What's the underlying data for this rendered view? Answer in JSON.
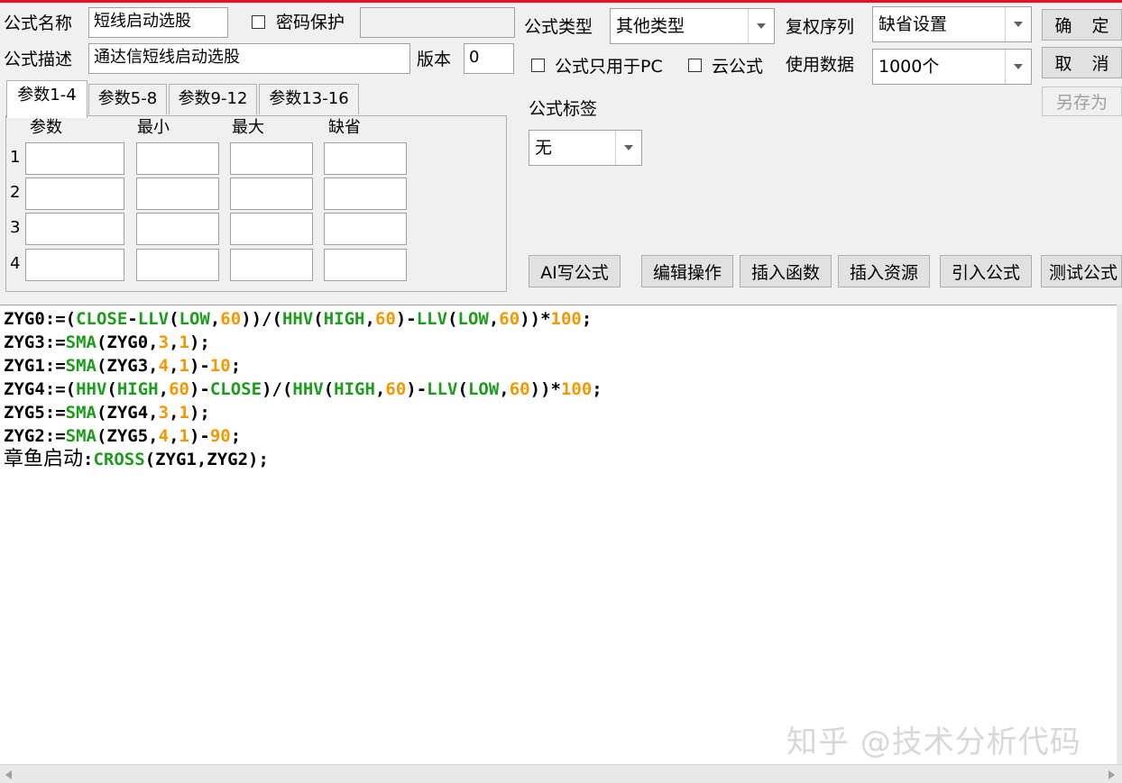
{
  "form": {
    "name_label": "公式名称",
    "name_value": "短线启动选股",
    "password_label": "密码保护",
    "desc_label": "公式描述",
    "desc_value": "通达信短线启动选股",
    "version_label": "版本",
    "version_value": "0"
  },
  "options": {
    "type_label": "公式类型",
    "type_value": "其他类型",
    "rights_label": "复权序列",
    "rights_value": "缺省设置",
    "pc_only_label": "公式只用于PC",
    "cloud_label": "云公式",
    "data_label": "使用数据",
    "data_value": "1000个",
    "tag_label": "公式标签",
    "tag_value": "无"
  },
  "buttons": {
    "ok": "确 定",
    "cancel": "取 消",
    "save_as": "另存为",
    "ai": "AI写公式",
    "edit": "编辑操作",
    "insert_func": "插入函数",
    "insert_res": "插入资源",
    "import": "引入公式",
    "test": "测试公式"
  },
  "params": {
    "tabs": [
      "参数1-4",
      "参数5-8",
      "参数9-12",
      "参数13-16"
    ],
    "headers": [
      "参数",
      "最小",
      "最大",
      "缺省"
    ],
    "rows": [
      "1",
      "2",
      "3",
      "4"
    ]
  },
  "code": {
    "line6_prefix": "章鱼启动",
    "watermark": "知乎 @技术分析代码"
  }
}
